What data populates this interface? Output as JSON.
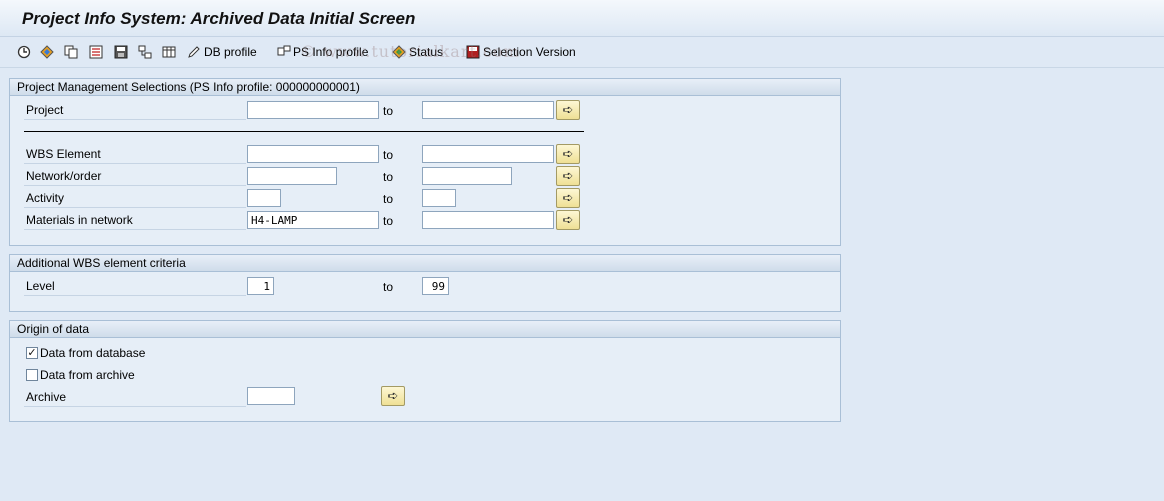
{
  "title": "Project Info System: Archived Data Initial Screen",
  "toolbar": {
    "db_profile": "DB profile",
    "ps_info_profile": "PS Info profile",
    "status": "Status",
    "selection_version": "Selection Version"
  },
  "watermark": "© www.tutorialkart.com",
  "group1": {
    "title": "Project Management Selections (PS Info profile: 000000000001)",
    "to": "to",
    "project": {
      "label": "Project",
      "from": "",
      "to_value": ""
    },
    "wbs": {
      "label": "WBS Element",
      "from": "",
      "to_value": ""
    },
    "network": {
      "label": "Network/order",
      "from": "",
      "to_value": ""
    },
    "activity": {
      "label": "Activity",
      "from": "",
      "to_value": ""
    },
    "materials": {
      "label": "Materials in network",
      "from": "H4-LAMP",
      "to_value": ""
    }
  },
  "group2": {
    "title": "Additional WBS element criteria",
    "to": "to",
    "level": {
      "label": "Level",
      "from": "1",
      "to_value": "99"
    }
  },
  "group3": {
    "title": "Origin of data",
    "from_database": {
      "label": "Data from database",
      "checked": true
    },
    "from_archive": {
      "label": "Data from archive",
      "checked": false
    },
    "archive": {
      "label": "Archive",
      "value": ""
    }
  },
  "colors": {
    "background": "#dfe9f5",
    "group_bg": "#e6eef7",
    "button_yellow": "#efe095"
  }
}
